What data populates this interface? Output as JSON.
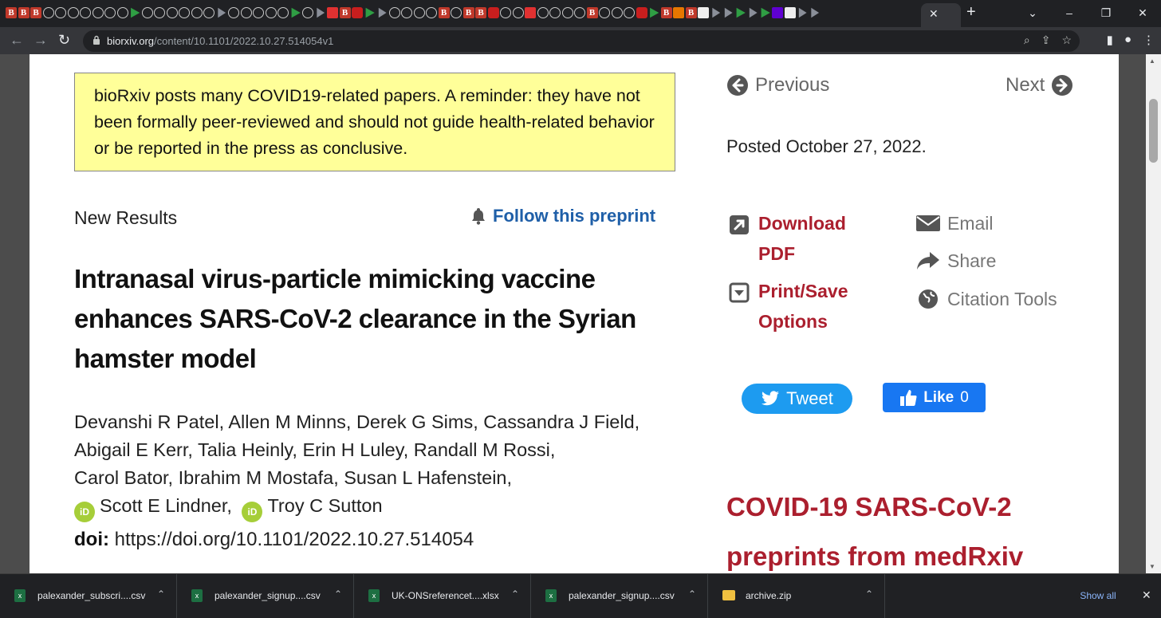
{
  "browser": {
    "url_host": "biorxiv.org",
    "url_path": "/content/10.1101/2022.10.27.514054v1",
    "new_tab_label": "+",
    "window_controls": [
      "⌄",
      "–",
      "❐",
      "✕"
    ]
  },
  "notice": {
    "text": "bioRxiv posts many COVID19-related papers. A reminder: they have not been formally peer-reviewed and should not guide health-related behavior or be reported in the press as conclusive."
  },
  "article": {
    "type": "New Results",
    "follow_label": "Follow this preprint",
    "title": "Intranasal virus-particle mimicking vaccine enhances SARS-CoV-2 clearance in the Syrian hamster model",
    "authors_line1": "Devanshi R Patel, Allen M Minns, Derek G Sims, Cassandra J Field,",
    "authors_line2": "Abigail E Kerr, Talia Heinly, Erin H Luley, Randall M Rossi,",
    "authors_line3": "Carol Bator, Ibrahim M Mostafa, Susan L Hafenstein,",
    "author_orcid_1": "Scott E Lindner,",
    "author_orcid_2": "Troy C Sutton",
    "doi_label": "doi:",
    "doi_value": "https://doi.org/10.1101/2022.10.27.514054",
    "orcid_badge": "iD"
  },
  "sidebar": {
    "previous_label": "Previous",
    "next_label": "Next",
    "posted": "Posted October 27, 2022.",
    "download_pdf": "Download PDF",
    "print_save": "Print/Save Options",
    "email": "Email",
    "share": "Share",
    "citation_tools": "Citation Tools",
    "tweet_label": "Tweet",
    "like_label": "Like",
    "like_count": "0",
    "covid_heading": "COVID-19 SARS-CoV-2 preprints from medRxiv"
  },
  "downloads": {
    "items": [
      {
        "name": "palexander_subscri....csv"
      },
      {
        "name": "palexander_signup....csv"
      },
      {
        "name": "UK-ONSreferencet....xlsx"
      },
      {
        "name": "palexander_signup....csv"
      },
      {
        "name": "archive.zip"
      }
    ],
    "show_all": "Show all"
  },
  "colors": {
    "notice_bg": "#ffff99",
    "link_blue": "#1f5fa8",
    "biorxiv_red": "#ab1f2e",
    "tweet_blue": "#1d9bf0",
    "facebook_blue": "#1877f2",
    "orcid_green": "#a6ce39"
  }
}
